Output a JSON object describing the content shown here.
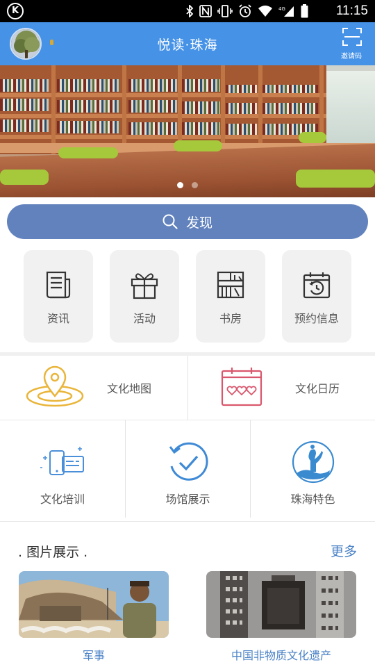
{
  "status_bar": {
    "time": "11:15",
    "icons": [
      "k-logo-icon",
      "bluetooth-icon",
      "nfc-icon",
      "vibrate-icon",
      "alarm-icon",
      "wifi-icon",
      "signal-icon",
      "battery-icon"
    ]
  },
  "header": {
    "title": "悦读·珠海",
    "scan_label": "邀请码",
    "color": "#4592e7"
  },
  "banner": {
    "slide_count": 2,
    "active_slide": 1
  },
  "search": {
    "label": "发现",
    "color": "#6182bd"
  },
  "quick_tiles": [
    {
      "label": "资讯",
      "icon": "news-icon"
    },
    {
      "label": "活动",
      "icon": "gift-icon"
    },
    {
      "label": "书房",
      "icon": "bookshelf-icon"
    },
    {
      "label": "预约信息",
      "icon": "calendar-clock-icon"
    }
  ],
  "features_row1": [
    {
      "label": "文化地图",
      "icon": "map-pin-icon"
    },
    {
      "label": "文化日历",
      "icon": "calendar-hearts-icon"
    }
  ],
  "features_row2": [
    {
      "label": "文化培训",
      "icon": "training-screen-icon"
    },
    {
      "label": "场馆展示",
      "icon": "venue-check-icon"
    },
    {
      "label": "珠海特色",
      "icon": "zhuhai-statue-icon"
    }
  ],
  "gallery": {
    "title": ". 图片展示 .",
    "more": "更多",
    "items": [
      {
        "caption": "军事"
      },
      {
        "caption": "中国非物质文化遗产"
      }
    ]
  },
  "colors": {
    "accent_blue": "#4a82c6",
    "gold": "#e9b53a",
    "pink": "#d9576d"
  }
}
